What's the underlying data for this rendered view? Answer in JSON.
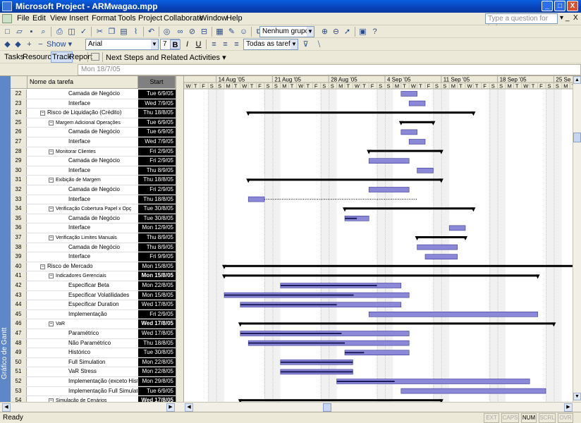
{
  "window": {
    "title": "Microsoft Project - ARMwagao.mpp",
    "min": "_",
    "max": "□",
    "close": "X"
  },
  "menu": {
    "items": [
      "File",
      "Edit",
      "View",
      "Insert",
      "Format",
      "Tools",
      "Project",
      "Collaborate",
      "Window",
      "Help"
    ],
    "help_placeholder": "Type a question for help",
    "help_arrow": "▾",
    "doc_minimize": "_",
    "doc_close": "X"
  },
  "toolbar": {
    "group_value": "Nenhum grupo",
    "font_value": "Arial",
    "size_value": "7",
    "show_label": "Show ▾",
    "filter_value": "Todas as tarefas",
    "bold": "B",
    "italic": "I",
    "underline": "U"
  },
  "guide": {
    "tasks": "Tasks",
    "resources": "Resources",
    "track": "Track",
    "report": "Report",
    "next_steps": "Next Steps and Related Activities ▾"
  },
  "entry_bar": {
    "value": "Mon 18/7/05"
  },
  "view_bar": {
    "label": "Gráfico de Gantt"
  },
  "table": {
    "col_name": "Nome da tarefa",
    "col_start": "Start",
    "rows": [
      {
        "id": "22",
        "name": "Camada de Negócio",
        "level": 4,
        "summary": false,
        "start": "Tue 6/9/05"
      },
      {
        "id": "23",
        "name": "Interface",
        "level": 4,
        "summary": false,
        "start": "Wed 7/9/05"
      },
      {
        "id": "24",
        "name": "Risco de Liquidação (Crédito)",
        "level": 2,
        "summary": true,
        "start": "Thu 18/8/05"
      },
      {
        "id": "25",
        "name": "Margem Adicional Operações",
        "level": 3,
        "summary": true,
        "start": "Tue 6/9/05"
      },
      {
        "id": "26",
        "name": "Camada de Negócio",
        "level": 4,
        "summary": false,
        "start": "Tue 6/9/05"
      },
      {
        "id": "27",
        "name": "Interface",
        "level": 4,
        "summary": false,
        "start": "Wed 7/9/05"
      },
      {
        "id": "28",
        "name": "Monitorar Clientes",
        "level": 3,
        "summary": true,
        "start": "Fri 2/9/05"
      },
      {
        "id": "29",
        "name": "Camada de Negócio",
        "level": 4,
        "summary": false,
        "start": "Fri 2/9/05"
      },
      {
        "id": "30",
        "name": "Interface",
        "level": 4,
        "summary": false,
        "start": "Thu 8/9/05"
      },
      {
        "id": "31",
        "name": "Exibição de Margem",
        "level": 3,
        "summary": true,
        "start": "Thu 18/8/05"
      },
      {
        "id": "32",
        "name": "Camada de Negócio",
        "level": 4,
        "summary": false,
        "start": "Fri 2/9/05"
      },
      {
        "id": "33",
        "name": "Interface",
        "level": 4,
        "summary": false,
        "start": "Thu 18/8/05"
      },
      {
        "id": "34",
        "name": "Verificação Cobertura Papel x Opç",
        "level": 3,
        "summary": true,
        "start": "Tue 30/8/05"
      },
      {
        "id": "35",
        "name": "Camada de Negócio",
        "level": 4,
        "summary": false,
        "start": "Tue 30/8/05"
      },
      {
        "id": "36",
        "name": "Interface",
        "level": 4,
        "summary": false,
        "start": "Mon 12/9/05"
      },
      {
        "id": "37",
        "name": "Verificação Limites Manuais",
        "level": 3,
        "summary": true,
        "start": "Thu 8/9/05"
      },
      {
        "id": "38",
        "name": "Camada de Negócio",
        "level": 4,
        "summary": false,
        "start": "Thu 8/9/05"
      },
      {
        "id": "39",
        "name": "Interface",
        "level": 4,
        "summary": false,
        "start": "Fri 9/9/05"
      },
      {
        "id": "40",
        "name": "Risco de Mercado",
        "level": 2,
        "summary": true,
        "start": "Mon 15/8/05"
      },
      {
        "id": "41",
        "name": "Indicadores Gerenciais",
        "level": 3,
        "summary": true,
        "start": "Mon 15/8/05"
      },
      {
        "id": "42",
        "name": "Especificar Beta",
        "level": 4,
        "summary": false,
        "start": "Mon 22/8/05"
      },
      {
        "id": "43",
        "name": "Especificar Volatilidades",
        "level": 4,
        "summary": false,
        "start": "Mon 15/8/05"
      },
      {
        "id": "44",
        "name": "Especificar Duration",
        "level": 4,
        "summary": false,
        "start": "Wed 17/8/05"
      },
      {
        "id": "45",
        "name": "Implementação",
        "level": 4,
        "summary": false,
        "start": "Fri 2/9/05"
      },
      {
        "id": "46",
        "name": "VaR",
        "level": 3,
        "summary": true,
        "start": "Wed 17/8/05"
      },
      {
        "id": "47",
        "name": "Paramétrico",
        "level": 4,
        "summary": false,
        "start": "Wed 17/8/05"
      },
      {
        "id": "48",
        "name": "Não Paramétrico",
        "level": 4,
        "summary": false,
        "start": "Thu 18/8/05"
      },
      {
        "id": "49",
        "name": "Histórico",
        "level": 4,
        "summary": false,
        "start": "Tue 30/8/05"
      },
      {
        "id": "50",
        "name": "Full Simulation",
        "level": 4,
        "summary": false,
        "start": "Mon 22/8/05"
      },
      {
        "id": "51",
        "name": "VaR Stress",
        "level": 4,
        "summary": false,
        "start": "Mon 22/8/05"
      },
      {
        "id": "52",
        "name": "Implementação (exceto Histo",
        "level": 4,
        "summary": false,
        "start": "Mon 29/8/05"
      },
      {
        "id": "53",
        "name": "Implementação Full Simulatio",
        "level": 4,
        "summary": false,
        "start": "Tue 6/9/05"
      },
      {
        "id": "54",
        "name": "Simulação de Cenários",
        "level": 3,
        "summary": true,
        "start": "Wed 17/8/05"
      }
    ]
  },
  "timescale": {
    "weeks": [
      "14 Aug '05",
      "21 Aug '05",
      "28 Aug '05",
      "4 Sep '05",
      "11 Sep '05",
      "18 Sep '05",
      "25 Se"
    ],
    "day_letters": [
      "W",
      "T",
      "F",
      "S",
      "S",
      "M",
      "T",
      "W",
      "T",
      "F",
      "S",
      "S",
      "M",
      "T",
      "W",
      "T",
      "F",
      "S",
      "S",
      "M",
      "T",
      "W",
      "T",
      "F",
      "S",
      "S",
      "M",
      "T",
      "W",
      "T",
      "F",
      "S",
      "S",
      "M",
      "T",
      "W",
      "T",
      "F",
      "S",
      "S",
      "M",
      "T",
      "W",
      "T",
      "F",
      "S",
      "S",
      "M",
      "T",
      "W",
      "T",
      "F",
      "S",
      "S",
      "M"
    ],
    "first_visible_date": "2005-08-10"
  },
  "colors": {
    "summary_bar": "#000000",
    "task_bar": "#8b88d8",
    "task_border": "#3a3896",
    "progress": "#1a1a5a",
    "weekend": "#dcdcdc"
  },
  "statusbar": {
    "ready": "Ready",
    "indicators": [
      "EXT",
      "CAPS",
      "NUM",
      "SCRL",
      "OVR"
    ],
    "active_indicator": "NUM"
  }
}
